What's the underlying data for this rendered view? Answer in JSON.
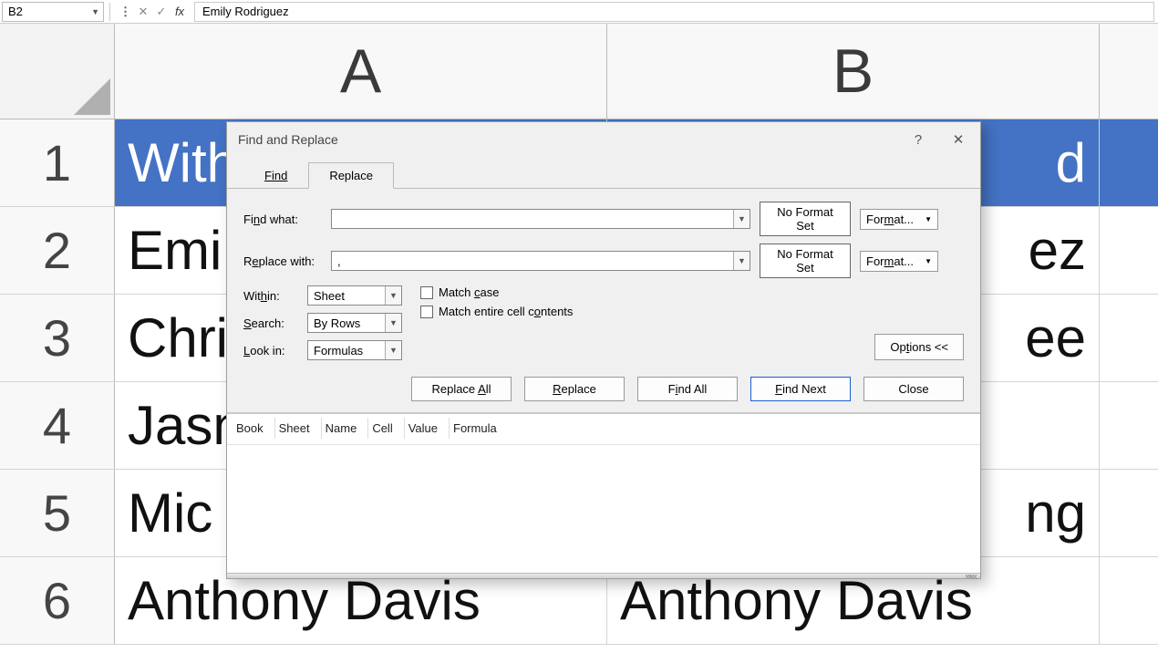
{
  "formulaBar": {
    "nameBox": "B2",
    "formula": "Emily Rodriguez"
  },
  "columns": [
    "A",
    "B"
  ],
  "rows": [
    {
      "num": "1",
      "a": "With",
      "b": "d",
      "header": true
    },
    {
      "num": "2",
      "a": "Emi",
      "b": "ez"
    },
    {
      "num": "3",
      "a": "Chri",
      "b": "ee"
    },
    {
      "num": "4",
      "a": "Jasn",
      "b": ""
    },
    {
      "num": "5",
      "a": "Mic",
      "b": "ng"
    },
    {
      "num": "6",
      "a": "Anthony Davis",
      "b": "Anthony Davis"
    }
  ],
  "dialog": {
    "title": "Find and Replace",
    "tabs": {
      "find": "Find",
      "replace": "Replace"
    },
    "labels": {
      "findWhat": "Find what:",
      "replaceWith": "Replace with:",
      "within": "Within:",
      "search": "Search:",
      "lookIn": "Look in:"
    },
    "values": {
      "findWhat": "",
      "replaceWith": ",",
      "within": "Sheet",
      "search": "By Rows",
      "lookIn": "Formulas"
    },
    "noFormat": "No Format Set",
    "formatBtn": "Format...",
    "checks": {
      "matchCase": "Match case",
      "matchEntire": "Match entire cell contents"
    },
    "optionsBtn": "Options <<",
    "buttons": {
      "replaceAll": "Replace All",
      "replace": "Replace",
      "findAll": "Find All",
      "findNext": "Find Next",
      "close": "Close"
    },
    "resultsCols": [
      "Book",
      "Sheet",
      "Name",
      "Cell",
      "Value",
      "Formula"
    ]
  }
}
